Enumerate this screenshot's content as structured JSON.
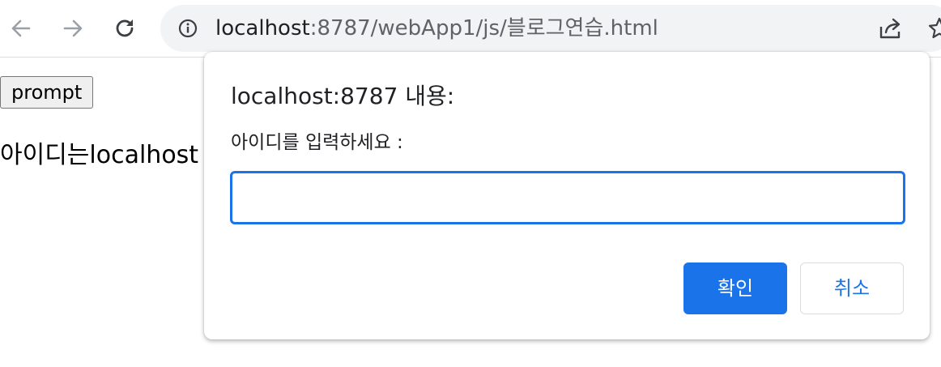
{
  "browser": {
    "url_host": "localhost",
    "url_rest": ":8787/webApp1/js/블로그연습.html",
    "icons": {
      "back": "arrow-left-icon",
      "forward": "arrow-right-icon",
      "reload": "reload-icon",
      "site_info": "info-icon",
      "share": "share-icon",
      "bookmark": "star-icon"
    }
  },
  "page": {
    "button_label": "prompt",
    "result_text": "아이디는localhost"
  },
  "dialog": {
    "title": "localhost:8787 내용:",
    "message": "아이디를 입력하세요 :",
    "input_value": "",
    "ok_label": "확인",
    "cancel_label": "취소",
    "accent_color": "#1a73e8"
  }
}
